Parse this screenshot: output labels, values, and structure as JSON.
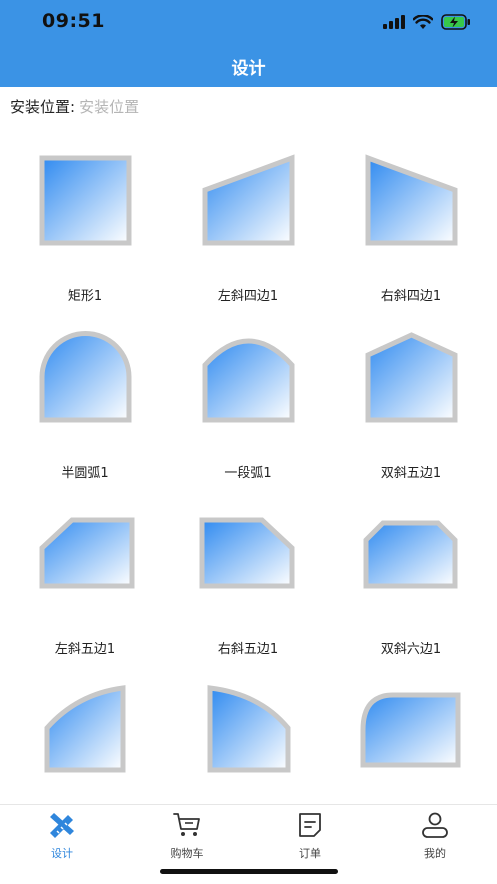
{
  "status_bar": {
    "time": "09:51"
  },
  "header": {
    "title": "设计"
  },
  "install_location": {
    "label": "安装位置:",
    "placeholder": "安装位置",
    "value": ""
  },
  "shapes": [
    {
      "name": "矩形1",
      "icon": "rectangle-window-icon"
    },
    {
      "name": "左斜四边1",
      "icon": "left-slant-quad-window-icon"
    },
    {
      "name": "右斜四边1",
      "icon": "right-slant-quad-window-icon"
    },
    {
      "name": "半圆弧1",
      "icon": "semicircle-arch-window-icon"
    },
    {
      "name": "一段弧1",
      "icon": "segment-arch-window-icon"
    },
    {
      "name": "双斜五边1",
      "icon": "double-slant-pentagon-window-icon"
    },
    {
      "name": "左斜五边1",
      "icon": "left-slant-pentagon-window-icon"
    },
    {
      "name": "右斜五边1",
      "icon": "right-slant-pentagon-window-icon"
    },
    {
      "name": "双斜六边1",
      "icon": "double-slant-hexagon-window-icon"
    },
    {
      "name": "",
      "icon": "left-arc-window-icon"
    },
    {
      "name": "",
      "icon": "right-arc-window-icon"
    },
    {
      "name": "",
      "icon": "rounded-corner-window-icon"
    }
  ],
  "tabbar": {
    "items": [
      {
        "label": "设计",
        "icon": "design-ruler-icon",
        "active": true
      },
      {
        "label": "购物车",
        "icon": "cart-icon",
        "active": false
      },
      {
        "label": "订单",
        "icon": "order-icon",
        "active": false
      },
      {
        "label": "我的",
        "icon": "profile-icon",
        "active": false
      }
    ]
  },
  "colors": {
    "primary": "#3b93e5",
    "frame": "#c8c8c8",
    "glass_top": "#2f8af0",
    "glass_bottom": "#ffffff"
  }
}
